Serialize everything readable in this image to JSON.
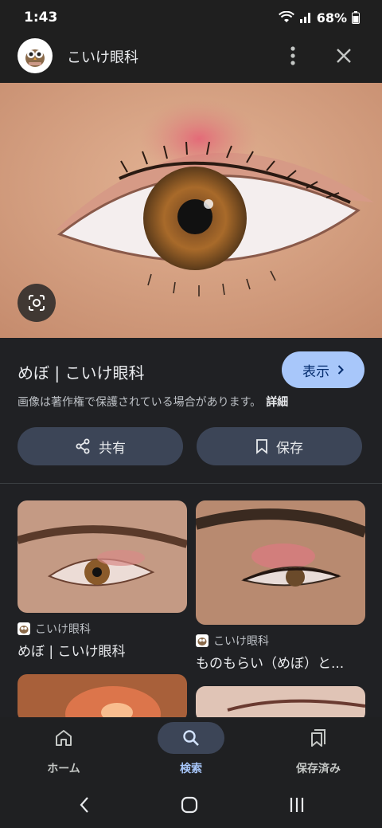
{
  "status_bar": {
    "time": "1:43",
    "battery": "68%"
  },
  "header": {
    "site_name": "こいけ眼科"
  },
  "result": {
    "title": "めぼ | こいけ眼科",
    "view_label": "表示",
    "copyright_notice": "画像は著作権で保護されている場合があります。",
    "details_label": "詳細"
  },
  "actions": {
    "share_label": "共有",
    "save_label": "保存"
  },
  "related": [
    {
      "source": "こいけ眼科",
      "title": "めぼ | こいけ眼科"
    },
    {
      "source": "こいけ眼科",
      "title": "ものもらい（めぼ）と..."
    }
  ],
  "bottom_nav": [
    {
      "label": "ホーム",
      "icon": "home-icon",
      "active": false
    },
    {
      "label": "検索",
      "icon": "search-icon",
      "active": true
    },
    {
      "label": "保存済み",
      "icon": "saved-icon",
      "active": false
    }
  ],
  "colors": {
    "accent": "#a8c7fa",
    "button_bg": "#3c4557",
    "background": "#202124"
  }
}
